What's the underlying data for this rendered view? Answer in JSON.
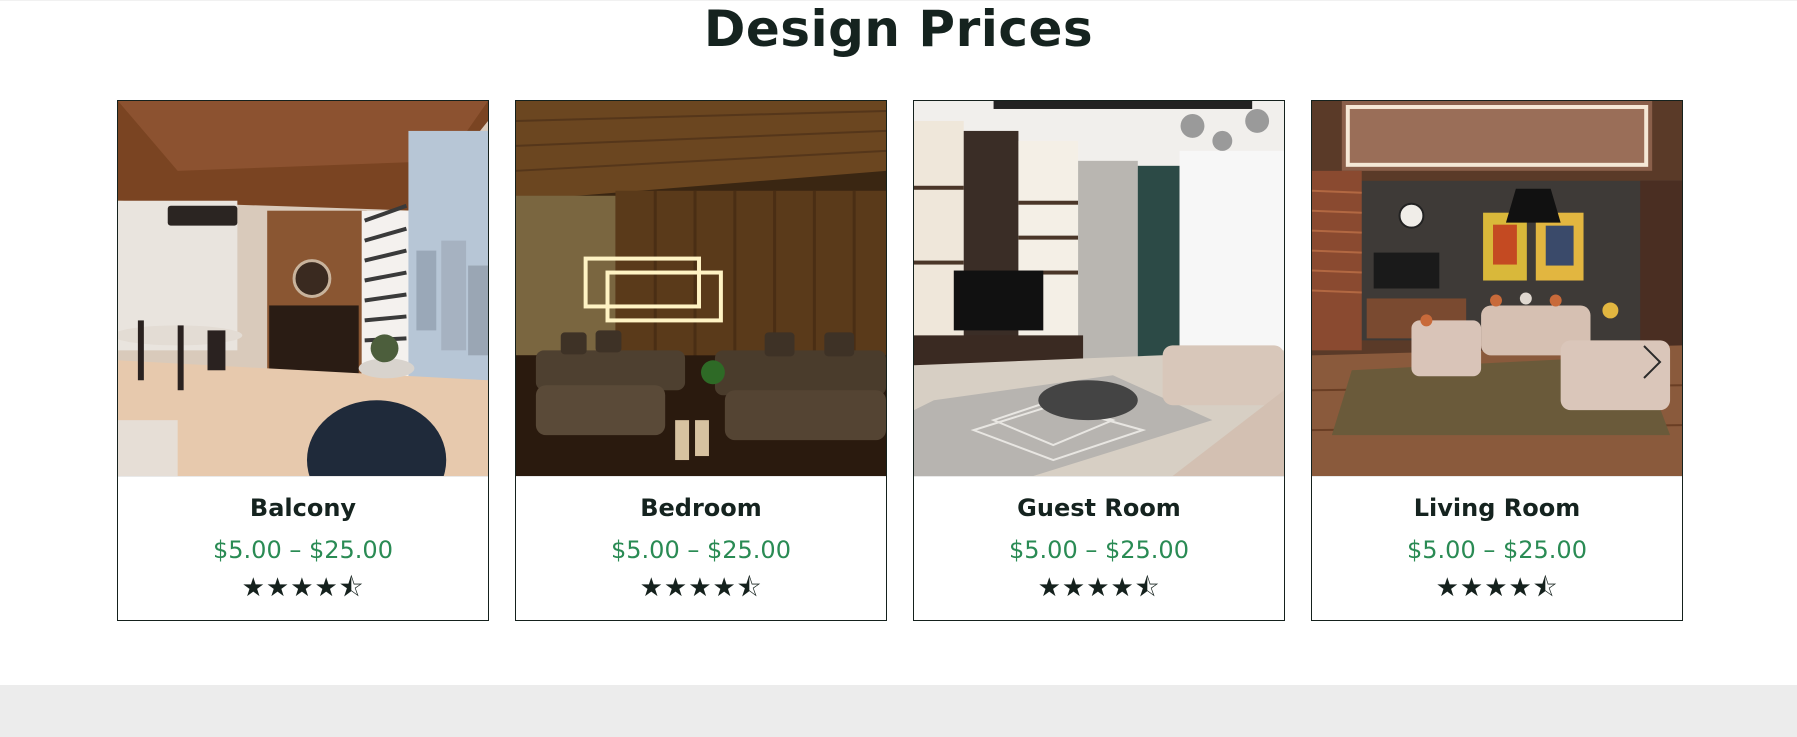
{
  "section": {
    "title": "Design Prices"
  },
  "cards": [
    {
      "name": "Balcony",
      "price": "$5.00 – $25.00",
      "rating": 4.5,
      "image": "balcony-interior-photo"
    },
    {
      "name": "Bedroom",
      "price": "$5.00 – $25.00",
      "rating": 4.5,
      "image": "bedroom-interior-photo"
    },
    {
      "name": "Guest Room",
      "price": "$5.00 – $25.00",
      "rating": 4.5,
      "image": "guest-room-interior-photo"
    },
    {
      "name": "Living Room",
      "price": "$5.00 – $25.00",
      "rating": 4.5,
      "image": "living-room-interior-photo"
    }
  ],
  "carousel": {
    "next_icon": "chevron-right-icon"
  },
  "colors": {
    "price": "#2a8b54",
    "heading": "#15231f",
    "border": "#15211d",
    "footer": "#ececec"
  }
}
